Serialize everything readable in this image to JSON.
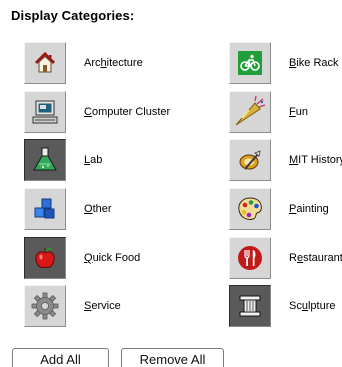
{
  "heading": "Display Categories:",
  "categories": [
    {
      "label": "Architecture",
      "icon": "house-icon",
      "selected": false
    },
    {
      "label": "Bike Rack",
      "icon": "bicycle-icon",
      "selected": false
    },
    {
      "label": "Computer Cluster",
      "icon": "computer-icon",
      "selected": false
    },
    {
      "label": "Fun",
      "icon": "party-horn-icon",
      "selected": false
    },
    {
      "label": "Lab",
      "icon": "flask-icon",
      "selected": true
    },
    {
      "label": "MIT History",
      "icon": "history-disc-icon",
      "selected": false
    },
    {
      "label": "Other",
      "icon": "blue-cubes-icon",
      "selected": false
    },
    {
      "label": "Painting",
      "icon": "palette-icon",
      "selected": false
    },
    {
      "label": "Quick Food",
      "icon": "apple-icon",
      "selected": true
    },
    {
      "label": "Restaurant",
      "icon": "fork-knife-icon",
      "selected": false
    },
    {
      "label": "Service",
      "icon": "gear-icon",
      "selected": false
    },
    {
      "label": "Sculpture",
      "icon": "column-icon",
      "selected": true
    }
  ],
  "buttons": {
    "add_all": "Add All",
    "remove_all": "Remove All"
  },
  "colors": {
    "tile": "#d6d6d6",
    "tile_selected": "#5a5a5a",
    "bike_green": "#1f9e3a",
    "restaurant_red": "#c21a1a"
  }
}
